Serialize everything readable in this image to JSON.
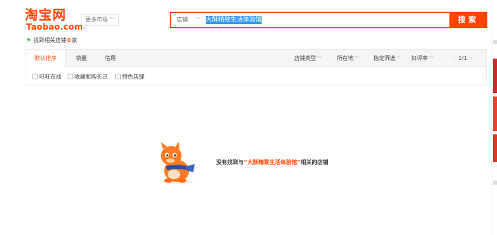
{
  "logo": {
    "cn": "淘宝网",
    "en": "Taobao.com"
  },
  "market_button": {
    "label": "更多市场",
    "caret": "﹀"
  },
  "search": {
    "type_label": "店铺",
    "type_caret": "﹀",
    "query": "大酥精致生活体验馆",
    "button_label": "搜索"
  },
  "found": {
    "prefix": "找到相关店铺",
    "count": "0",
    "suffix": "家",
    "flag": "⚑"
  },
  "sort_tabs": [
    "默认排序",
    "销量",
    "信用"
  ],
  "filters": [
    {
      "label": "店铺类型",
      "caret": "﹀"
    },
    {
      "label": "所在地",
      "caret": "﹀"
    },
    {
      "label": "指定筛选",
      "caret": "﹀"
    },
    {
      "label": "好评率",
      "caret": "﹀"
    }
  ],
  "pager": {
    "prev": "‹",
    "page": "1/1",
    "next": "›"
  },
  "checkboxes": [
    "旺旺在线",
    "收藏和购买过",
    "特色店铺"
  ],
  "empty": {
    "before": "没有找到与",
    "keyword": "“大酥精致生活体验馆”",
    "after": "相关的店铺"
  },
  "colors": {
    "accent": "#ff4400",
    "link_selected": "#3399ff"
  }
}
